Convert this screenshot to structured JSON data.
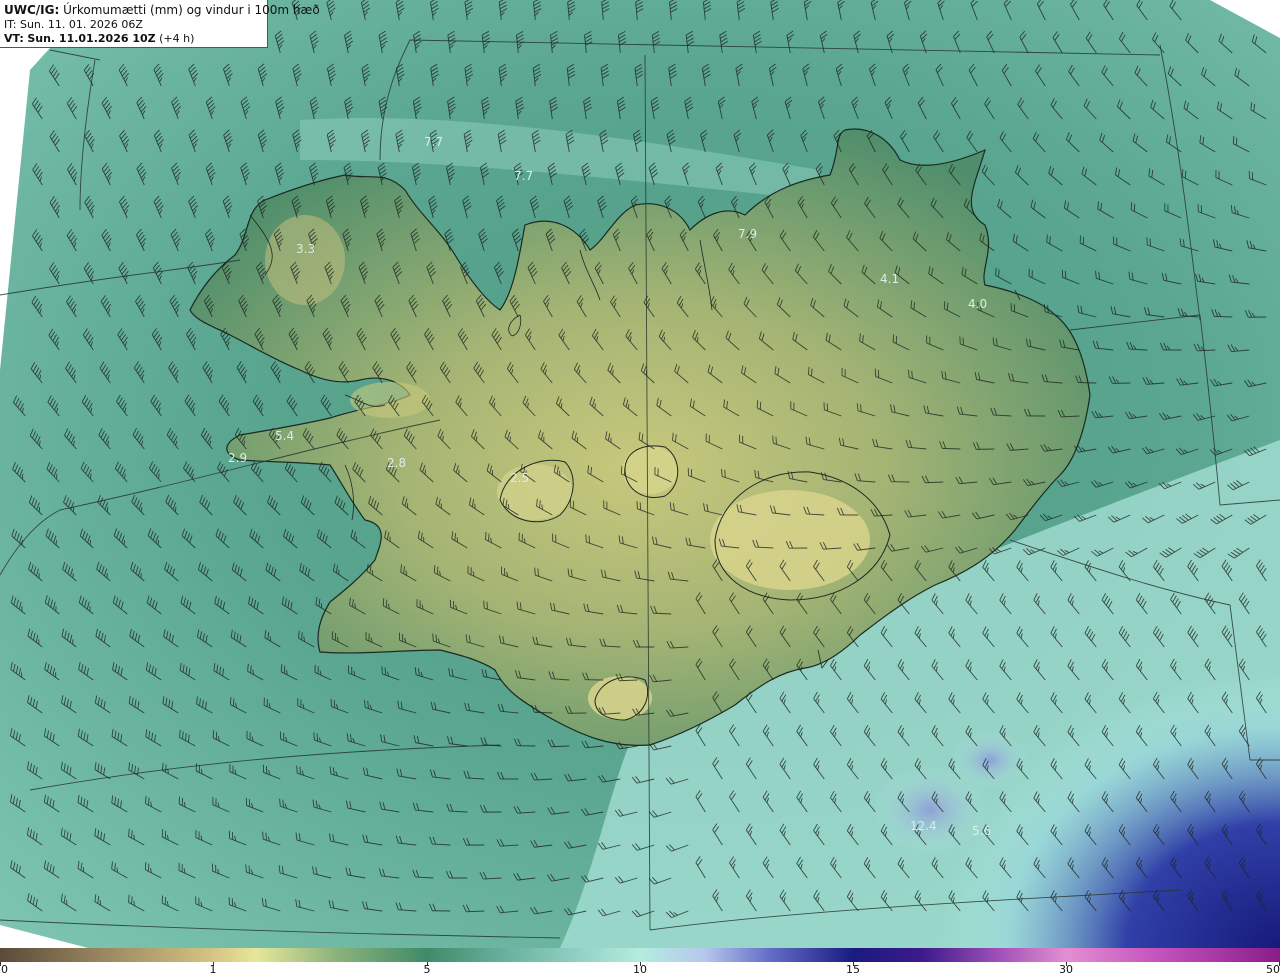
{
  "header": {
    "product": "UWC/IG:",
    "title": "Úrkomumætti (mm) og vindur i 100m hæð",
    "init_time": "IT: Sun. 11. 01. 2026 06Z",
    "valid_prefix": "VT:",
    "valid_time": "Sun. 11.01.2026 10Z",
    "valid_offset": "(+4 h)"
  },
  "map": {
    "value_labels": [
      "3.3",
      "7.7",
      "7.7",
      "7.9",
      "4.1",
      "4.0",
      "5.4",
      "2.9",
      "2.8",
      "2.5",
      "5.6",
      "12.4"
    ]
  },
  "colorbar": {
    "ticks": [
      "0",
      "1",
      "5",
      "10",
      "15",
      "30",
      "50"
    ],
    "colors": [
      "#5a4a38",
      "#d6c483",
      "#3f8b68",
      "#b4ece0",
      "#1a1a80",
      "#e48ed2",
      "#8a1c8a"
    ]
  }
}
